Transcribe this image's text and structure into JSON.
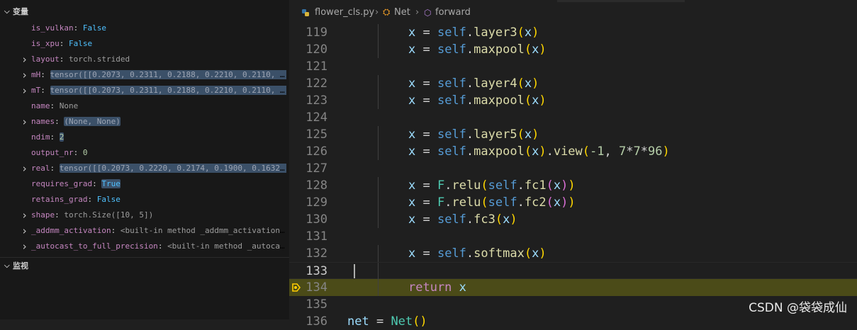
{
  "sidebar": {
    "variables_title": "变量",
    "watch_title": "监视",
    "variables": [
      {
        "name": "is_vulkan",
        "value": "False",
        "kind": "bool",
        "expandable": false,
        "highlight": false
      },
      {
        "name": "is_xpu",
        "value": "False",
        "kind": "bool",
        "expandable": false,
        "highlight": false
      },
      {
        "name": "layout",
        "value": "torch.strided",
        "kind": "str",
        "expandable": true,
        "highlight": false
      },
      {
        "name": "mH",
        "value": "tensor([[0.2073, 0.2311, 0.2188, 0.2210, 0.2110, 0…",
        "kind": "str",
        "expandable": true,
        "highlight": true
      },
      {
        "name": "mT",
        "value": "tensor([[0.2073, 0.2311, 0.2188, 0.2210, 0.2110, 0…",
        "kind": "str",
        "expandable": true,
        "highlight": true
      },
      {
        "name": "name",
        "value": "None",
        "kind": "str",
        "expandable": false,
        "highlight": false
      },
      {
        "name": "names",
        "value": "(None, None)",
        "kind": "str",
        "expandable": true,
        "highlight": true
      },
      {
        "name": "ndim",
        "value": "2",
        "kind": "num",
        "expandable": false,
        "highlight": true
      },
      {
        "name": "output_nr",
        "value": "0",
        "kind": "num",
        "expandable": false,
        "highlight": false
      },
      {
        "name": "real",
        "value": "tensor([[0.2073, 0.2220, 0.2174, 0.1900, 0.1632],",
        "kind": "str",
        "expandable": true,
        "highlight": true
      },
      {
        "name": "requires_grad",
        "value": "True",
        "kind": "bool",
        "expandable": false,
        "highlight": true
      },
      {
        "name": "retains_grad",
        "value": "False",
        "kind": "bool",
        "expandable": false,
        "highlight": false
      },
      {
        "name": "shape",
        "value": "torch.Size([10, 5])",
        "kind": "str",
        "expandable": true,
        "highlight": false
      },
      {
        "name": "_addmm_activation",
        "value": "<built-in method _addmm_activation …",
        "kind": "str",
        "expandable": true,
        "highlight": false
      },
      {
        "name": "_autocast_to_full_precision",
        "value": "<built-in method _autocas…",
        "kind": "str",
        "expandable": true,
        "highlight": false
      }
    ]
  },
  "editor": {
    "breadcrumb": {
      "file": "flower_cls.py",
      "class": "Net",
      "method": "forward"
    },
    "lines": [
      {
        "num": "119",
        "tokens": [
          [
            "x",
            "var"
          ],
          [
            " = ",
            "op"
          ],
          [
            "self",
            "self"
          ],
          [
            ".",
            "op"
          ],
          [
            "layer3",
            "fn"
          ],
          [
            "(",
            "p1"
          ],
          [
            "x",
            "var"
          ],
          [
            ")",
            "p1"
          ]
        ]
      },
      {
        "num": "120",
        "tokens": [
          [
            "x",
            "var"
          ],
          [
            " = ",
            "op"
          ],
          [
            "self",
            "self"
          ],
          [
            ".",
            "op"
          ],
          [
            "maxpool",
            "fn"
          ],
          [
            "(",
            "p1"
          ],
          [
            "x",
            "var"
          ],
          [
            ")",
            "p1"
          ]
        ]
      },
      {
        "num": "121",
        "tokens": []
      },
      {
        "num": "122",
        "tokens": [
          [
            "x",
            "var"
          ],
          [
            " = ",
            "op"
          ],
          [
            "self",
            "self"
          ],
          [
            ".",
            "op"
          ],
          [
            "layer4",
            "fn"
          ],
          [
            "(",
            "p1"
          ],
          [
            "x",
            "var"
          ],
          [
            ")",
            "p1"
          ]
        ]
      },
      {
        "num": "123",
        "tokens": [
          [
            "x",
            "var"
          ],
          [
            " = ",
            "op"
          ],
          [
            "self",
            "self"
          ],
          [
            ".",
            "op"
          ],
          [
            "maxpool",
            "fn"
          ],
          [
            "(",
            "p1"
          ],
          [
            "x",
            "var"
          ],
          [
            ")",
            "p1"
          ]
        ]
      },
      {
        "num": "124",
        "tokens": []
      },
      {
        "num": "125",
        "tokens": [
          [
            "x",
            "var"
          ],
          [
            " = ",
            "op"
          ],
          [
            "self",
            "self"
          ],
          [
            ".",
            "op"
          ],
          [
            "layer5",
            "fn"
          ],
          [
            "(",
            "p1"
          ],
          [
            "x",
            "var"
          ],
          [
            ")",
            "p1"
          ]
        ]
      },
      {
        "num": "126",
        "tokens": [
          [
            "x",
            "var"
          ],
          [
            " = ",
            "op"
          ],
          [
            "self",
            "self"
          ],
          [
            ".",
            "op"
          ],
          [
            "maxpool",
            "fn"
          ],
          [
            "(",
            "p1"
          ],
          [
            "x",
            "var"
          ],
          [
            ")",
            "p1"
          ],
          [
            ".",
            "op"
          ],
          [
            "view",
            "fn"
          ],
          [
            "(",
            "p1"
          ],
          [
            "-1",
            "num"
          ],
          [
            ", ",
            "op"
          ],
          [
            "7",
            "num"
          ],
          [
            "*",
            "op"
          ],
          [
            "7",
            "num"
          ],
          [
            "*",
            "op"
          ],
          [
            "96",
            "num"
          ],
          [
            ")",
            "p1"
          ]
        ]
      },
      {
        "num": "127",
        "tokens": []
      },
      {
        "num": "128",
        "tokens": [
          [
            "x",
            "var"
          ],
          [
            " = ",
            "op"
          ],
          [
            "F",
            "cls"
          ],
          [
            ".",
            "op"
          ],
          [
            "relu",
            "fn"
          ],
          [
            "(",
            "p1"
          ],
          [
            "self",
            "self"
          ],
          [
            ".",
            "op"
          ],
          [
            "fc1",
            "fn"
          ],
          [
            "(",
            "p2"
          ],
          [
            "x",
            "var"
          ],
          [
            ")",
            "p2"
          ],
          [
            ")",
            "p1"
          ]
        ]
      },
      {
        "num": "129",
        "tokens": [
          [
            "x",
            "var"
          ],
          [
            " = ",
            "op"
          ],
          [
            "F",
            "cls"
          ],
          [
            ".",
            "op"
          ],
          [
            "relu",
            "fn"
          ],
          [
            "(",
            "p1"
          ],
          [
            "self",
            "self"
          ],
          [
            ".",
            "op"
          ],
          [
            "fc2",
            "fn"
          ],
          [
            "(",
            "p2"
          ],
          [
            "x",
            "var"
          ],
          [
            ")",
            "p2"
          ],
          [
            ")",
            "p1"
          ]
        ]
      },
      {
        "num": "130",
        "tokens": [
          [
            "x",
            "var"
          ],
          [
            " = ",
            "op"
          ],
          [
            "self",
            "self"
          ],
          [
            ".",
            "op"
          ],
          [
            "fc3",
            "fn"
          ],
          [
            "(",
            "p1"
          ],
          [
            "x",
            "var"
          ],
          [
            ")",
            "p1"
          ]
        ]
      },
      {
        "num": "131",
        "tokens": []
      },
      {
        "num": "132",
        "tokens": [
          [
            "x",
            "var"
          ],
          [
            " = ",
            "op"
          ],
          [
            "self",
            "self"
          ],
          [
            ".",
            "op"
          ],
          [
            "softmax",
            "fn"
          ],
          [
            "(",
            "p1"
          ],
          [
            "x",
            "var"
          ],
          [
            ")",
            "p1"
          ]
        ]
      },
      {
        "num": "133",
        "tokens": [],
        "cursor": true
      },
      {
        "num": "134",
        "tokens": [
          [
            "return",
            "kw"
          ],
          [
            " ",
            "op"
          ],
          [
            "x",
            "var"
          ]
        ],
        "debug": true
      },
      {
        "num": "135",
        "tokens": []
      },
      {
        "num": "136",
        "tokens": [
          [
            "net",
            "var"
          ],
          [
            " = ",
            "op"
          ],
          [
            "Net",
            "cls"
          ],
          [
            "()",
            "p1"
          ]
        ],
        "partial": true
      }
    ]
  },
  "watermark": "CSDN @袋袋成仙",
  "colors": {
    "debug_line": "#4b4b18",
    "breakpoint_arrow": "#ffcc00"
  }
}
